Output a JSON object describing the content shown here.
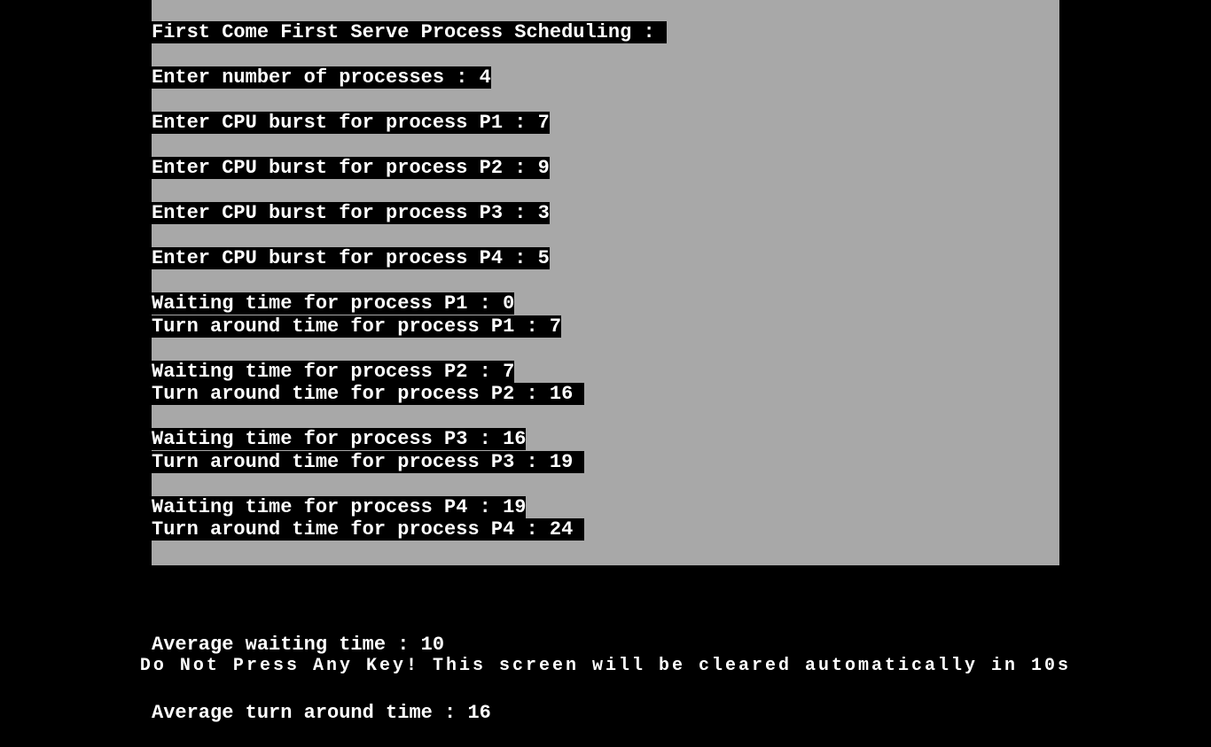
{
  "title": "First Come First Serve Process Scheduling : ",
  "prompts": {
    "num_proc_label": "Enter number of processes : ",
    "num_proc_value": "4",
    "bursts": [
      {
        "label": "Enter CPU burst for process P1 : ",
        "value": "7"
      },
      {
        "label": "Enter CPU burst for process P2 : ",
        "value": "9"
      },
      {
        "label": "Enter CPU burst for process P3 : ",
        "value": "3"
      },
      {
        "label": "Enter CPU burst for process P4 : ",
        "value": "5"
      }
    ]
  },
  "results": [
    {
      "wait_label": "Waiting time for process P1 : ",
      "wait_value": "0",
      "tat_label": "Turn around time for process P1 : ",
      "tat_value": "7"
    },
    {
      "wait_label": "Waiting time for process P2 : ",
      "wait_value": "7",
      "tat_label": "Turn around time for process P2 : ",
      "tat_value": "16 "
    },
    {
      "wait_label": "Waiting time for process P3 : ",
      "wait_value": "16",
      "tat_label": "Turn around time for process P3 : ",
      "tat_value": "19 "
    },
    {
      "wait_label": "Waiting time for process P4 : ",
      "wait_value": "19",
      "tat_label": "Turn around time for process P4 : ",
      "tat_value": "24 "
    }
  ],
  "averages": {
    "wait_label": "Average waiting time : ",
    "wait_value": "10",
    "tat_label": "Average turn around time : ",
    "tat_value": "16"
  },
  "footer": "Do Not Press Any Key! This screen will be cleared automatically in 10s"
}
